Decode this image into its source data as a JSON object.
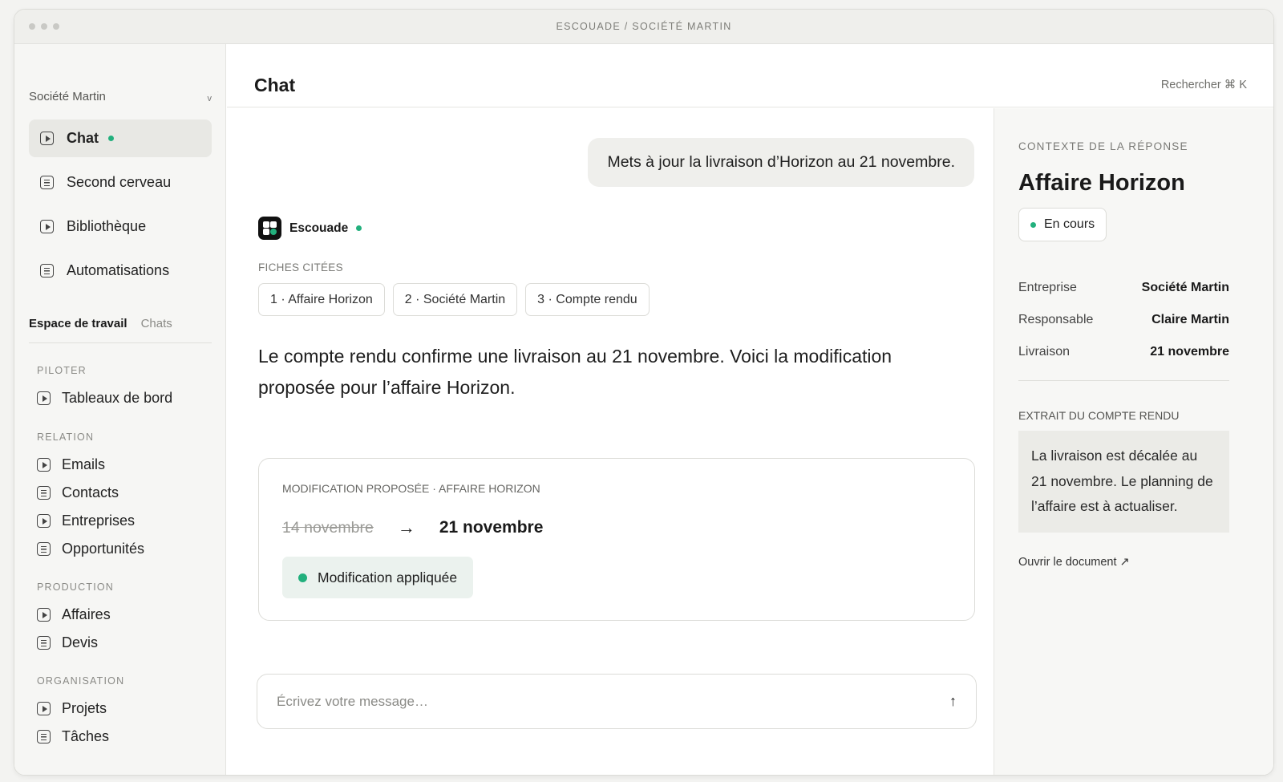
{
  "window": {
    "title": "ESCOUADE / SOCIÉTÉ MARTIN"
  },
  "sidebar": {
    "org_name": "Société Martin",
    "org_chevron": "v",
    "main_items": [
      {
        "label": "Chat",
        "icon": "play-square-icon",
        "active": true
      },
      {
        "label": "Second cerveau",
        "icon": "document-icon"
      },
      {
        "label": "Bibliothèque",
        "icon": "play-square-icon"
      },
      {
        "label": "Automatisations",
        "icon": "document-icon"
      }
    ],
    "tabs": {
      "workspace": "Espace de travail",
      "chats": "Chats"
    },
    "sections": [
      {
        "title": "PILOTER",
        "items": [
          "Tableaux de bord"
        ]
      },
      {
        "title": "RELATION",
        "items": [
          "Emails",
          "Contacts",
          "Entreprises",
          "Opportunités"
        ]
      },
      {
        "title": "PRODUCTION",
        "items": [
          "Affaires",
          "Devis"
        ]
      },
      {
        "title": "ORGANISATION",
        "items": [
          "Projets",
          "Tâches"
        ]
      }
    ]
  },
  "header": {
    "title": "Chat",
    "search_hint": "Rechercher ⌘ K"
  },
  "chat": {
    "user_message": "Mets à jour la livraison d’Horizon au 21 novembre.",
    "bot_name": "Escouade",
    "cited_label": "FICHES CITÉES",
    "chips": [
      "1 · Affaire Horizon",
      "2 · Société Martin",
      "3 · Compte rendu"
    ],
    "answer": "Le compte rendu confirme une livraison au 21 novembre. Voici la modification proposée pour l’affaire Horizon.",
    "proposal": {
      "label": "MODIFICATION PROPOSÉE · AFFAIRE HORIZON",
      "old_value": "14 novembre",
      "arrow": "→",
      "new_value": "21 novembre",
      "status": "Modification appliquée"
    },
    "composer": {
      "placeholder": "Écrivez votre message…",
      "send_glyph": "↑"
    }
  },
  "context": {
    "label": "CONTEXTE DE LA RÉPONSE",
    "title": "Affaire Horizon",
    "status": "En cours",
    "fields": [
      {
        "key": "Entreprise",
        "value": "Société Martin"
      },
      {
        "key": "Responsable",
        "value": "Claire Martin"
      },
      {
        "key": "Livraison",
        "value": "21 novembre"
      }
    ],
    "excerpt_label": "EXTRAIT DU COMPTE RENDU",
    "excerpt": "La livraison est décalée au 21 novembre. Le planning de l’affaire est à actualiser.",
    "open_link": "Ouvrir le document ↗"
  },
  "colors": {
    "accent_green": "#22b07d",
    "applied_bg": "#ebf2ee"
  }
}
